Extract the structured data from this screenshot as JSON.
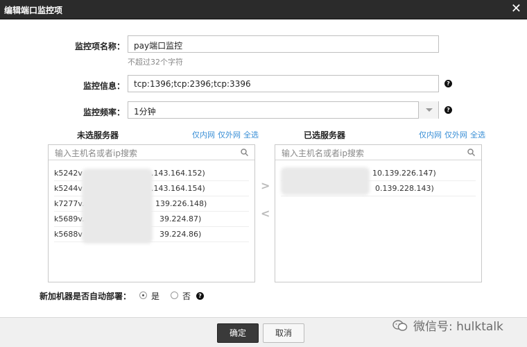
{
  "dialog": {
    "title": "编辑端口监控项",
    "close_glyph": "✕"
  },
  "form": {
    "name_label": "监控项名称：",
    "name_value": "pay端口监控",
    "name_hint": "不超过32个字符",
    "info_label": "监控信息：",
    "info_value": "tcp:1396;tcp:2396;tcp:3396",
    "freq_label": "监控频率：",
    "freq_value": "1分钟",
    "help_glyph": "?"
  },
  "left_panel": {
    "title": "未选服务器",
    "links": [
      "仅内网",
      "仅外网",
      "全选"
    ],
    "search_placeholder": "输入主机名或者ip搜索",
    "items": [
      {
        "prefix": "k5242v",
        "suffix": ".143.164.152)"
      },
      {
        "prefix": "k5244v",
        "suffix": ".143.164.154)"
      },
      {
        "prefix": "k7277v.a",
        "suffix": "139.226.148)"
      },
      {
        "prefix": "k5689v.a",
        "suffix": "39.224.87)"
      },
      {
        "prefix": "k5688v",
        "suffix": "39.224.86)"
      }
    ]
  },
  "right_panel": {
    "title": "已选服务器",
    "links": [
      "仅内网",
      "仅外网",
      "全选"
    ],
    "search_placeholder": "输入主机名或者ip搜索",
    "items": [
      {
        "prefix": "",
        "suffix": "10.139.226.147)"
      },
      {
        "prefix": "",
        "suffix": "0.139.228.143)"
      }
    ]
  },
  "transfer": {
    "add_glyph": ">",
    "remove_glyph": "<"
  },
  "auto_deploy": {
    "label": "新加机器是否自动部署：",
    "options": [
      "是",
      "否"
    ],
    "selected": "是"
  },
  "footer": {
    "ok_label": "确定",
    "cancel_label": "取消"
  },
  "watermark": {
    "text": "微信号: hulktalk"
  }
}
